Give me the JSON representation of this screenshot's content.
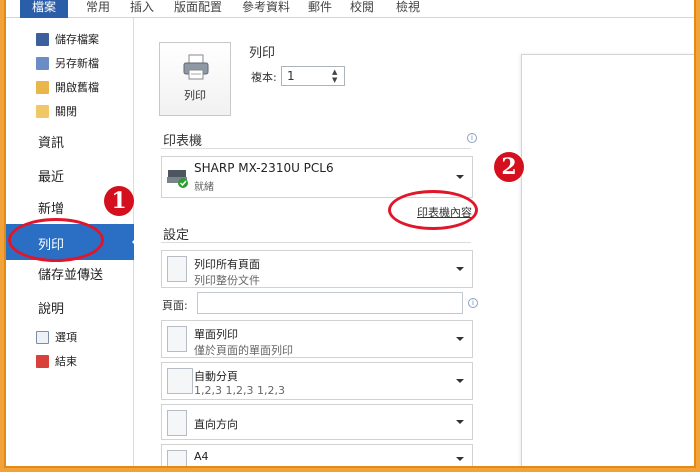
{
  "ribbon": {
    "tabs": [
      "檔案",
      "常用",
      "插入",
      "版面配置",
      "參考資料",
      "郵件",
      "校閱",
      "檢視"
    ]
  },
  "nav": {
    "small_items": [
      {
        "label": "儲存檔案",
        "icon": "save-icon"
      },
      {
        "label": "另存新檔",
        "icon": "save-as-icon"
      },
      {
        "label": "開啟舊檔",
        "icon": "open-folder-icon"
      },
      {
        "label": "關閉",
        "icon": "close-folder-icon"
      }
    ],
    "big_items": [
      "資訊",
      "最近",
      "新增",
      "列印",
      "儲存並傳送",
      "說明"
    ],
    "selected": "列印",
    "bottom_items": [
      {
        "label": "選項",
        "icon": "options-icon"
      },
      {
        "label": "結束",
        "icon": "exit-icon"
      }
    ]
  },
  "print": {
    "section_title": "列印",
    "button_label": "列印",
    "copies_label": "複本:",
    "copies_value": "1"
  },
  "printer": {
    "section_title": "印表機",
    "name": "SHARP MX-2310U PCL6",
    "status": "就緒",
    "properties_link": "印表機內容"
  },
  "settings": {
    "section_title": "設定",
    "pages_label": "頁面:",
    "options": [
      {
        "title": "列印所有頁面",
        "subtitle": "列印整份文件"
      },
      {
        "title": "單面列印",
        "subtitle": "僅於頁面的單面列印"
      },
      {
        "title": "自動分頁",
        "subtitle": "1,2,3    1,2,3    1,2,3"
      },
      {
        "title": "直向方向",
        "subtitle": ""
      },
      {
        "title": "A4",
        "subtitle": ""
      }
    ]
  },
  "annotations": {
    "badge1": "1",
    "badge2": "2",
    "color": "#e0162b"
  },
  "colors": {
    "accent": "#2a6fc4",
    "frame": "#e48a12"
  }
}
